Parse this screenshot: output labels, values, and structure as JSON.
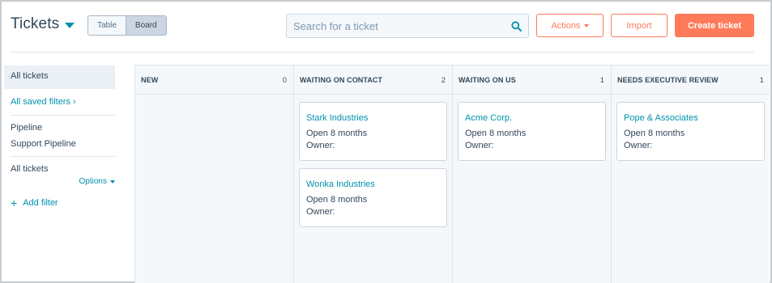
{
  "header": {
    "title": "Tickets",
    "view_toggle": {
      "table_label": "Table",
      "board_label": "Board",
      "active": "Board"
    },
    "search": {
      "placeholder": "Search for a ticket"
    },
    "actions_label": "Actions",
    "import_label": "Import",
    "create_label": "Create ticket"
  },
  "colors": {
    "accent": "#ff7a59",
    "link": "#0091ae",
    "text": "#33475b",
    "board_bg": "#f5f8fa"
  },
  "sidebar": {
    "active_view": "All tickets",
    "saved_filters_label": "All saved filters",
    "pipeline_heading": "Pipeline",
    "pipeline_value": "Support Pipeline",
    "filter_heading": "All tickets",
    "options_label": "Options",
    "add_filter_label": "Add filter"
  },
  "board": {
    "columns": [
      {
        "label": "NEW",
        "count": "0",
        "cards": []
      },
      {
        "label": "WAITING ON CONTACT",
        "count": "2",
        "cards": [
          {
            "name": "Stark Industries",
            "open": "Open 8 months",
            "owner": "Owner:"
          },
          {
            "name": "Wonka Industries",
            "open": "Open 8 months",
            "owner": "Owner:"
          }
        ]
      },
      {
        "label": "WAITING ON US",
        "count": "1",
        "cards": [
          {
            "name": "Acme Corp.",
            "open": "Open 8 months",
            "owner": "Owner:"
          }
        ]
      },
      {
        "label": "NEEDS EXECUTIVE REVIEW",
        "count": "1",
        "cards": [
          {
            "name": "Pope & Associates",
            "open": "Open 8 months",
            "owner": "Owner:"
          }
        ]
      }
    ]
  }
}
